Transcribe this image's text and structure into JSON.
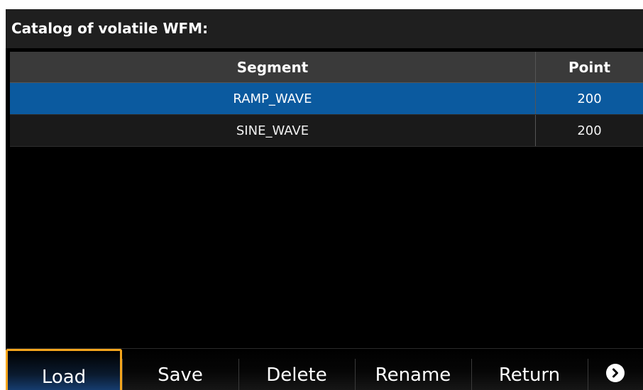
{
  "title": "Catalog of volatile WFM:",
  "table": {
    "headers": [
      "Segment",
      "Point"
    ],
    "rows": [
      {
        "segment": "RAMP_WAVE",
        "point": "200",
        "selected": true
      },
      {
        "segment": "SINE_WAVE",
        "point": "200",
        "selected": false
      }
    ]
  },
  "softkeys": [
    {
      "label": "Load",
      "active": true
    },
    {
      "label": "Save",
      "active": false
    },
    {
      "label": "Delete",
      "active": false
    },
    {
      "label": "Rename",
      "active": false
    },
    {
      "label": "Return",
      "active": false
    }
  ],
  "more_icon": "chevron-right-circle-icon",
  "colors": {
    "selected_row": "#0b5a9f",
    "active_key_border": "#f4a51c",
    "background": "#000000"
  }
}
